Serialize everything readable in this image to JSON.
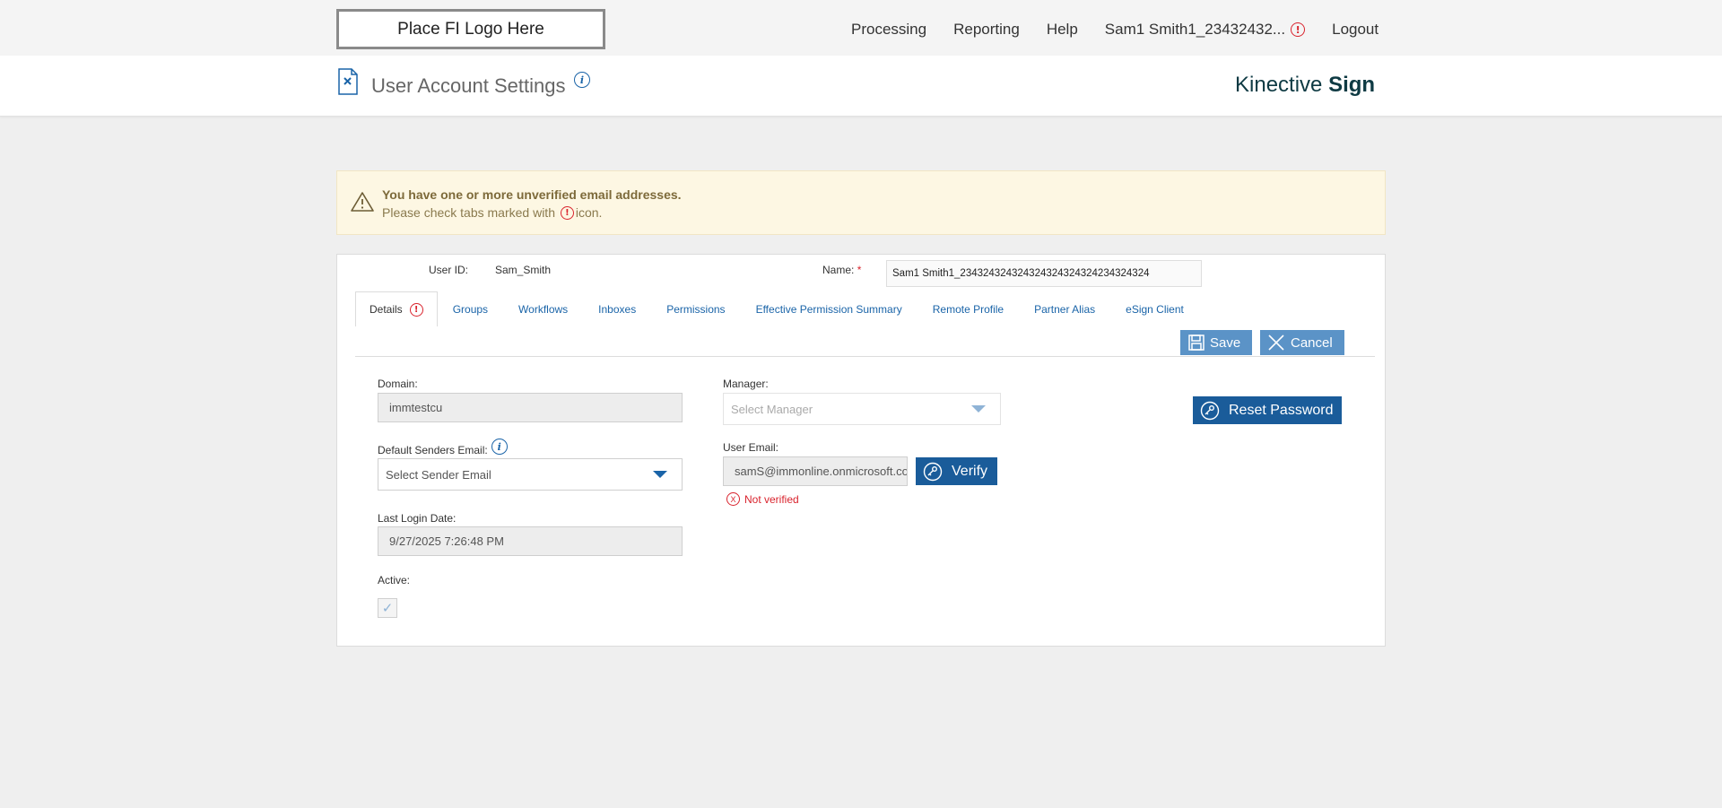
{
  "topbar": {
    "logo_text": "Place FI Logo Here",
    "nav": {
      "processing": "Processing",
      "reporting": "Reporting",
      "help": "Help",
      "user": "Sam1 Smith1_23432432...",
      "logout": "Logout"
    }
  },
  "header": {
    "title": "User Account Settings",
    "brand_light": "Kinective ",
    "brand_bold": "Sign"
  },
  "warning": {
    "title": "You have one or more unverified email addresses.",
    "text_before": "Please check tabs marked with",
    "text_after": "icon."
  },
  "account": {
    "user_id_label": "User ID:",
    "user_id_value": "Sam_Smith",
    "name_label": "Name:",
    "name_required": "*",
    "name_value": "Sam1 Smith1_234324324324324324324324234324324"
  },
  "tabs": [
    {
      "label": "Details"
    },
    {
      "label": "Groups"
    },
    {
      "label": "Workflows"
    },
    {
      "label": "Inboxes"
    },
    {
      "label": "Permissions"
    },
    {
      "label": "Effective Permission Summary"
    },
    {
      "label": "Remote Profile"
    },
    {
      "label": "Partner Alias"
    },
    {
      "label": "eSign Client"
    }
  ],
  "actions": {
    "save": "Save",
    "cancel": "Cancel",
    "reset_password": "Reset Password",
    "verify": "Verify"
  },
  "details": {
    "domain_label": "Domain:",
    "domain_value": "immtestcu",
    "default_sender_label": "Default Senders Email:",
    "default_sender_placeholder": "Select Sender Email",
    "last_login_label": "Last Login Date:",
    "last_login_value": "9/27/2025 7:26:48 PM",
    "active_label": "Active:",
    "active_checked": true,
    "manager_label": "Manager:",
    "manager_placeholder": "Select Manager",
    "user_email_label": "User Email:",
    "user_email_value": "samS@immonline.onmicrosoft.com",
    "email_status": "Not verified"
  },
  "colors": {
    "primary": "#1a5c9a",
    "primary_light": "#5b93c7",
    "error": "#d9232d",
    "warning_bg": "#fdf7e3"
  }
}
